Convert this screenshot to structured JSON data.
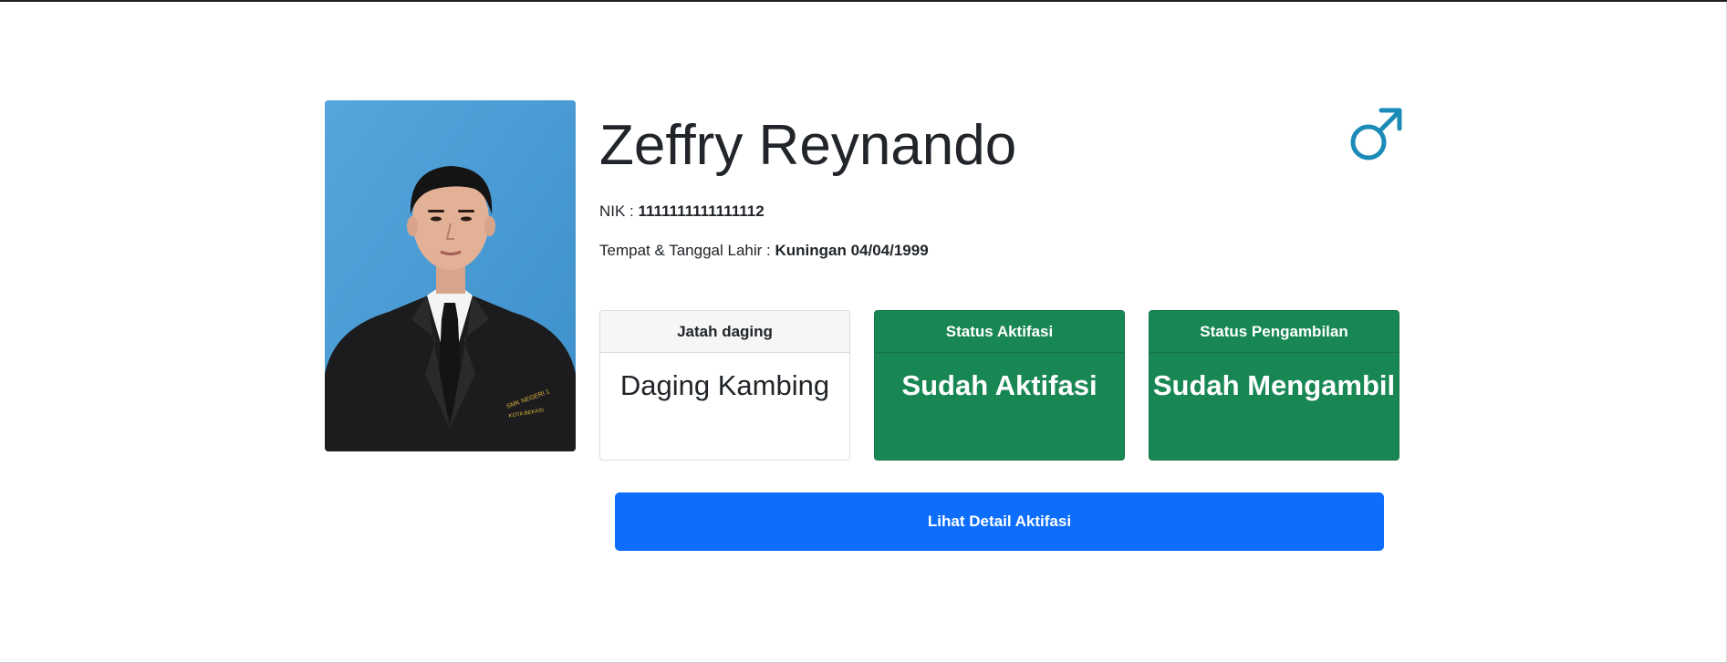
{
  "profile": {
    "name": "Zeffry Reynando",
    "gender_icon": "male-icon",
    "gender_color": "#1b8bb8",
    "photo_badge_text": "SMK NEGERI 1 KOTA BEKASI"
  },
  "info": {
    "nik_label": "NIK : ",
    "nik_value": "1111111111111112",
    "ttl_label": "Tempat & Tanggal Lahir : ",
    "ttl_value": "Kuningan 04/04/1999"
  },
  "cards": {
    "jatah": {
      "header": "Jatah daging",
      "value": "Daging Kambing"
    },
    "aktifasi": {
      "header": "Status Aktifasi",
      "value": "Sudah Aktifasi"
    },
    "pengambilan": {
      "header": "Status Pengambilan",
      "value": "Sudah Mengambil"
    }
  },
  "actions": {
    "detail_label": "Lihat Detail Aktifasi"
  },
  "colors": {
    "success": "#198754",
    "primary": "#0d6efd",
    "photo_background": "#4d9fd8"
  }
}
